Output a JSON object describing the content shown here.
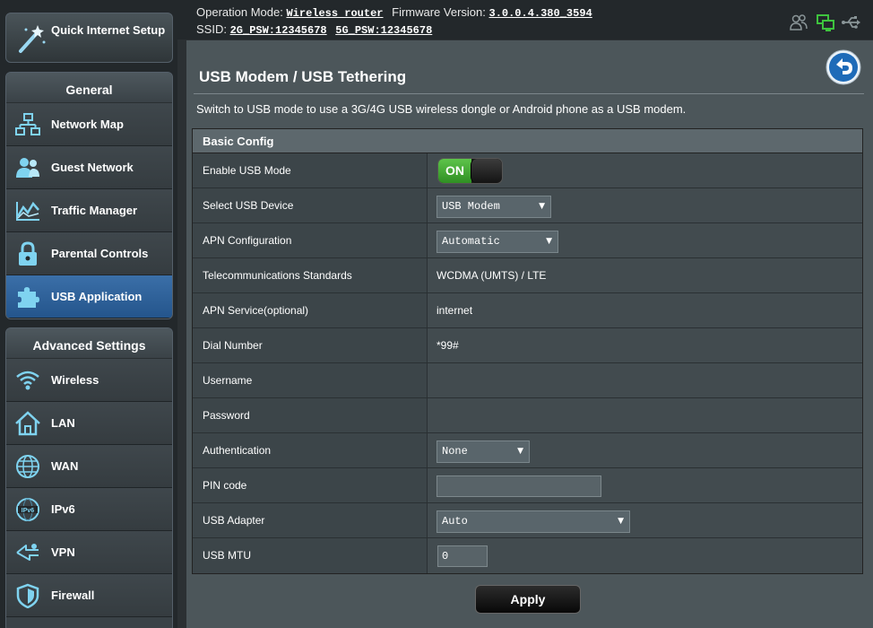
{
  "topbar": {
    "operation_mode_label": "Operation Mode:",
    "operation_mode_value": "Wireless router",
    "firmware_label": "Firmware Version:",
    "firmware_value": "3.0.0.4.380_3594",
    "ssid_label": "SSID:",
    "ssid_2g": "2G_PSW:12345678",
    "ssid_5g": "5G_PSW:12345678",
    "status_icons": [
      "clients-icon",
      "network-status-icon",
      "usb-icon"
    ]
  },
  "sidebar": {
    "quick_setup_label": "Quick Internet Setup",
    "general_header": "General",
    "general_items": [
      {
        "label": "Network Map",
        "icon": "network-map-icon"
      },
      {
        "label": "Guest Network",
        "icon": "guest-network-icon"
      },
      {
        "label": "Traffic Manager",
        "icon": "traffic-manager-icon"
      },
      {
        "label": "Parental Controls",
        "icon": "lock-icon"
      },
      {
        "label": "USB Application",
        "icon": "puzzle-icon",
        "active": true
      }
    ],
    "advanced_header": "Advanced Settings",
    "advanced_items": [
      {
        "label": "Wireless",
        "icon": "wifi-icon"
      },
      {
        "label": "LAN",
        "icon": "home-icon"
      },
      {
        "label": "WAN",
        "icon": "globe-icon"
      },
      {
        "label": "IPv6",
        "icon": "ipv6-icon"
      },
      {
        "label": "VPN",
        "icon": "vpn-icon"
      },
      {
        "label": "Firewall",
        "icon": "shield-icon"
      }
    ]
  },
  "main": {
    "title": "USB Modem / USB Tethering",
    "description": "Switch to USB mode to use a 3G/4G USB wireless dongle or Android phone as a USB modem.",
    "section_header": "Basic Config",
    "rows": {
      "enable_usb_mode": {
        "label": "Enable USB Mode",
        "value": "ON"
      },
      "select_usb_device": {
        "label": "Select USB Device",
        "value": "USB Modem"
      },
      "apn_configuration": {
        "label": "APN Configuration",
        "value": "Automatic"
      },
      "telecom_standards": {
        "label": "Telecommunications Standards",
        "value": "WCDMA (UMTS) / LTE"
      },
      "apn_service": {
        "label": "APN Service(optional)",
        "value": "internet"
      },
      "dial_number": {
        "label": "Dial Number",
        "value": "*99#"
      },
      "username": {
        "label": "Username",
        "value": ""
      },
      "password": {
        "label": "Password",
        "value": ""
      },
      "authentication": {
        "label": "Authentication",
        "value": "None"
      },
      "pin_code": {
        "label": "PIN code",
        "value": ""
      },
      "usb_adapter": {
        "label": "USB Adapter",
        "value": "Auto"
      },
      "usb_mtu": {
        "label": "USB MTU",
        "value": "0"
      }
    },
    "apply_label": "Apply"
  },
  "colors": {
    "toggle_on": "#3aa12e",
    "active_nav": "#2f62a0",
    "icon_accent": "#7fd3f0",
    "status_green": "#3ec43e"
  }
}
